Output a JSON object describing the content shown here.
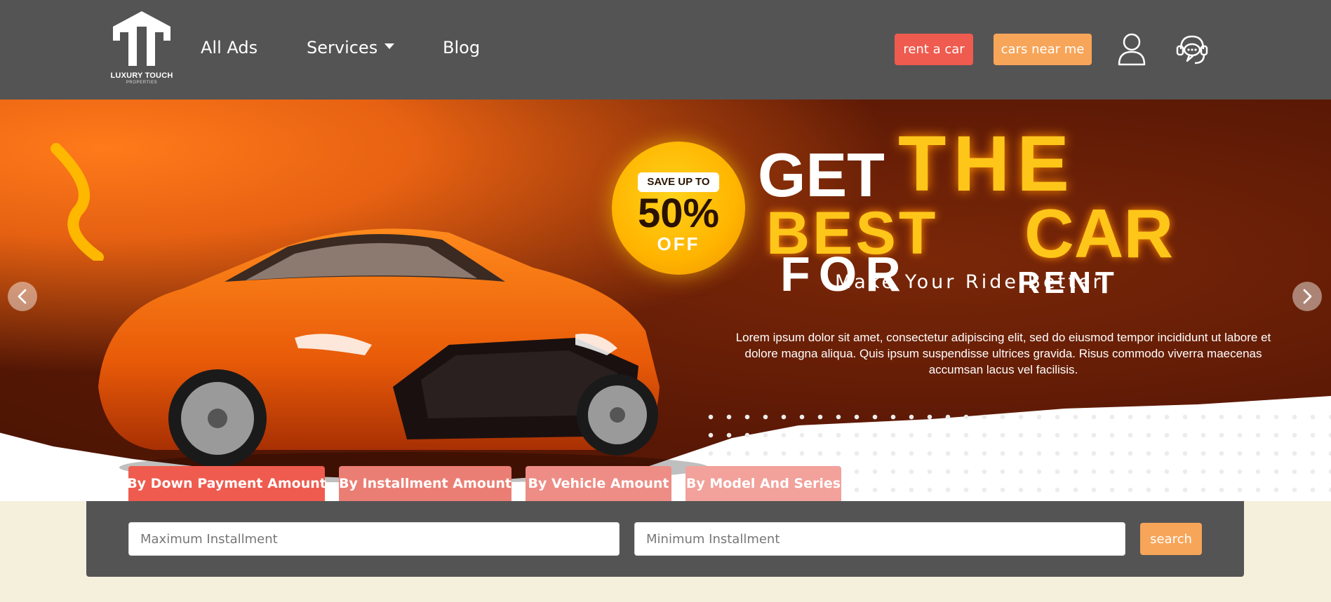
{
  "brand": {
    "name": "LUXURY TOUCH",
    "tagline": "PROPERTIES"
  },
  "nav": {
    "all_ads": "All Ads",
    "services": "Services",
    "blog": "Blog"
  },
  "header_actions": {
    "rent_car": "rent a car",
    "cars_near_me": "cars near me",
    "user_icon": "user-icon",
    "support_icon": "support-headset-icon"
  },
  "hero": {
    "badge_save": "SAVE UP TO",
    "badge_percent": "50%",
    "badge_off": "OFF",
    "headline_get": "GET",
    "headline_the": "THE",
    "headline_best": "BEST",
    "headline_car": "CAR",
    "headline_for": "FOR",
    "headline_rent": "RENT",
    "tagline": "Make Your Ride Better",
    "body": "Lorem ipsum dolor sit amet, consectetur adipiscing elit, sed do eiusmod tempor incididunt ut labore et dolore magna aliqua. Quis ipsum suspendisse ultrices gravida. Risus commodo viverra maecenas accumsan lacus vel facilisis."
  },
  "tabs": [
    {
      "label": "By Down Payment Amount"
    },
    {
      "label": "By Installment Amount"
    },
    {
      "label": "By Vehicle Amount"
    },
    {
      "label": "By Model And Series"
    }
  ],
  "search": {
    "max_placeholder": "Maximum Installment",
    "min_placeholder": "Minimum Installment",
    "button": "search"
  },
  "colors": {
    "navbar_bg": "#545454",
    "accent_red": "#ef5b4f",
    "accent_orange": "#f7a559",
    "page_bg": "#f5f0dc"
  }
}
